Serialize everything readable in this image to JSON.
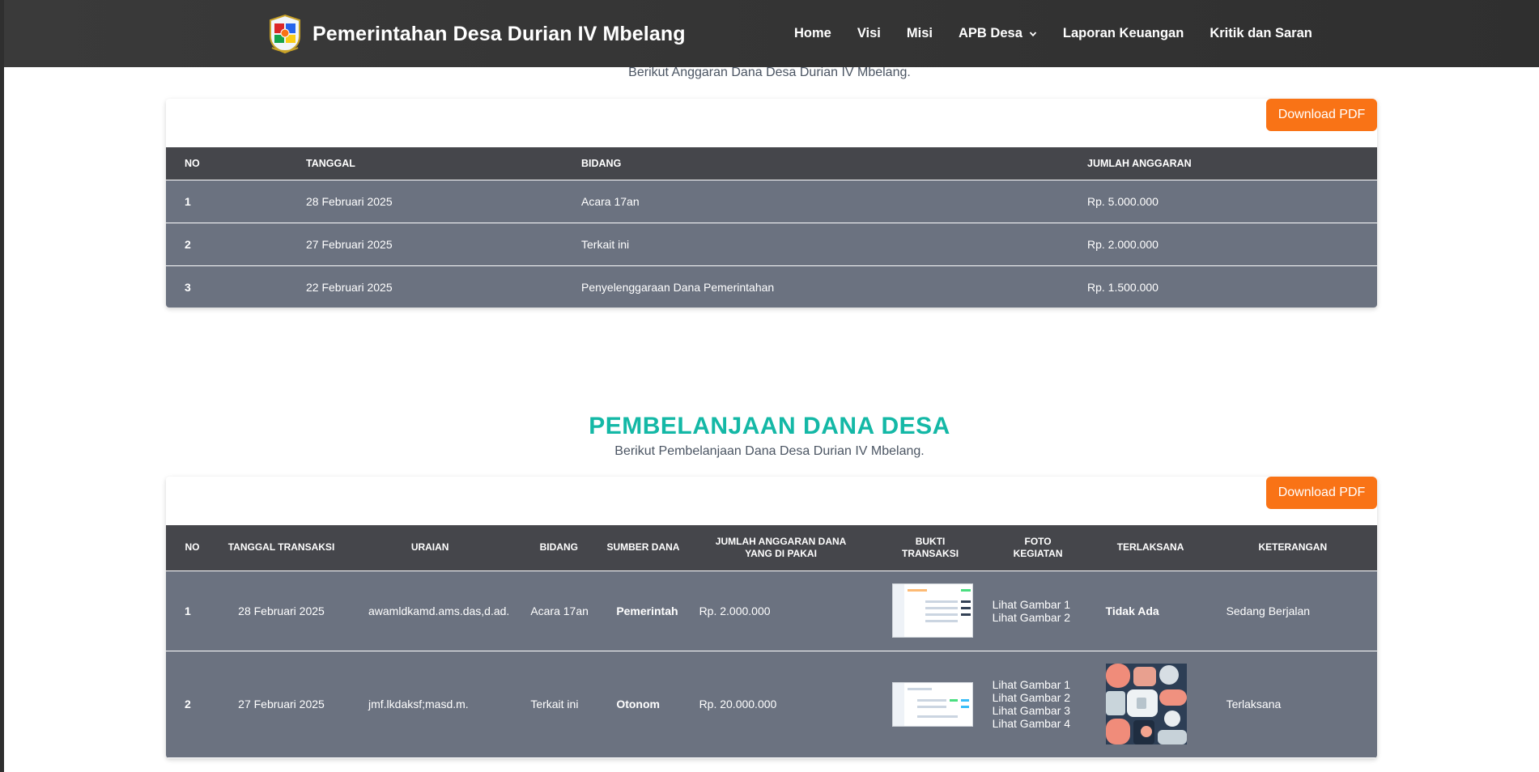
{
  "navbar": {
    "brand_title": "Pemerintahan Desa Durian IV Mbelang",
    "items": [
      "Home",
      "Visi",
      "Misi",
      "APB Desa",
      "Laporan Keuangan",
      "Kritik dan Saran"
    ]
  },
  "anggaran": {
    "subtitle": "Berikut Anggaran Dana Desa Durian IV Mbelang.",
    "download_label": "Download PDF",
    "headers": [
      "NO",
      "TANGGAL",
      "BIDANG",
      "JUMLAH ANGGARAN"
    ],
    "rows": [
      {
        "no": "1",
        "tanggal": "28 Februari 2025",
        "bidang": "Acara 17an",
        "jumlah": "Rp. 5.000.000"
      },
      {
        "no": "2",
        "tanggal": "27 Februari 2025",
        "bidang": "Terkait ini",
        "jumlah": "Rp. 2.000.000"
      },
      {
        "no": "3",
        "tanggal": "22 Februari 2025",
        "bidang": "Penyelenggaraan Dana Pemerintahan",
        "jumlah": "Rp. 1.500.000"
      }
    ]
  },
  "pembelanjaan": {
    "title": "PEMBELANJAAN DANA DESA",
    "subtitle": "Berikut Pembelanjaan Dana Desa Durian IV Mbelang.",
    "download_label": "Download PDF",
    "headers": [
      "NO",
      "TANGGAL TRANSAKSI",
      "URAIAN",
      "BIDANG",
      "SUMBER DANA",
      "JUMLAH ANGGARAN DANA YANG DI PAKAI",
      "BUKTI TRANSAKSI",
      "FOTO KEGIATAN",
      "TERLAKSANA",
      "KETERANGAN"
    ],
    "rows": [
      {
        "no": "1",
        "tanggal": "28 Februari 2025",
        "uraian": "awamldkamd.ams.das,d.ad.",
        "bidang": "Acara 17an",
        "sumber": "Pemerintah",
        "jumlah": "Rp. 2.000.000",
        "foto_links": [
          "Lihat Gambar 1",
          "Lihat Gambar 2"
        ],
        "terlaksana": "Tidak Ada",
        "keterangan": "Sedang Berjalan"
      },
      {
        "no": "2",
        "tanggal": "27 Februari 2025",
        "uraian": "jmf.lkdaksf;masd.m.",
        "bidang": "Terkait ini",
        "sumber": "Otonom",
        "jumlah": "Rp. 20.000.000",
        "foto_links": [
          "Lihat Gambar 1",
          "Lihat Gambar 2",
          "Lihat Gambar 3",
          "Lihat Gambar 4"
        ],
        "terlaksana": "",
        "keterangan": "Terlaksana"
      }
    ]
  },
  "colors": {
    "accent_teal": "#14b8a6",
    "button_orange": "#f97316",
    "header_dark": "#45464b",
    "row_gray": "#6b7280"
  }
}
